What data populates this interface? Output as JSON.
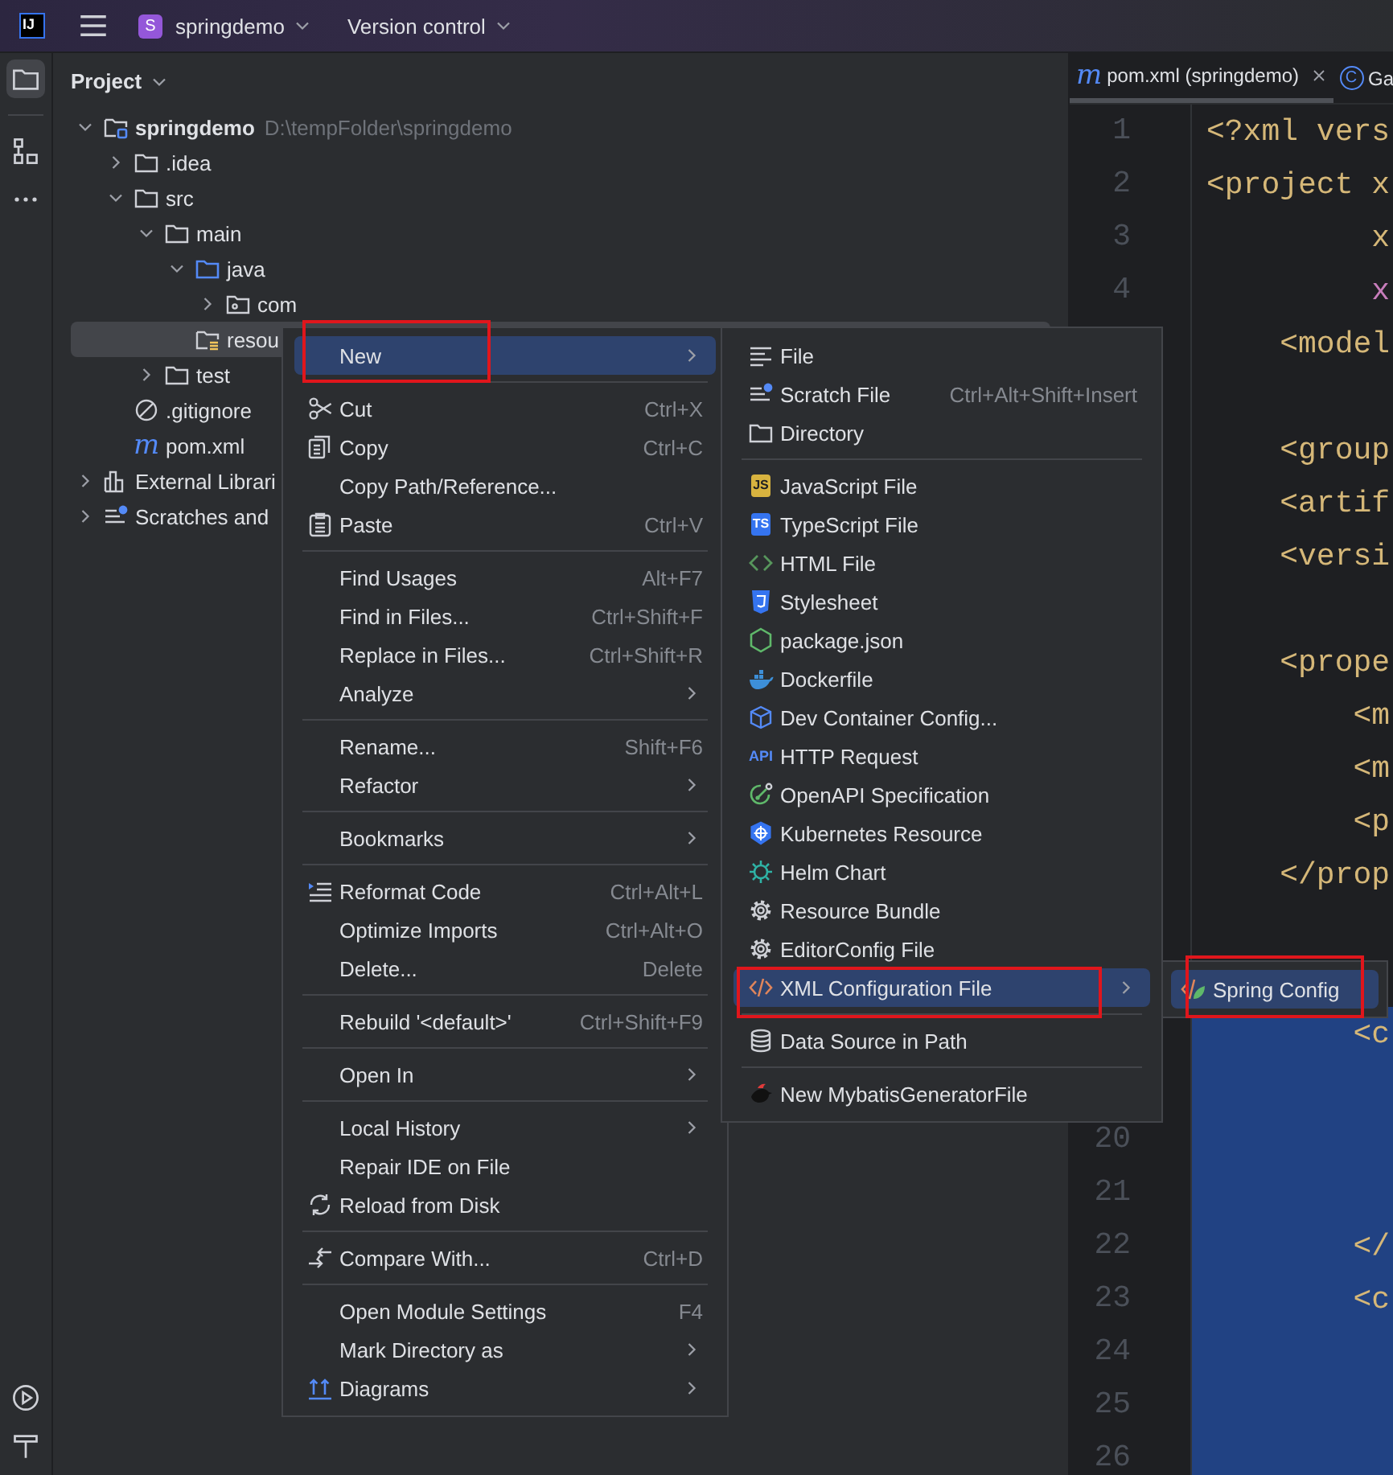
{
  "title_bar": {
    "logo": "IJ",
    "project_badge": "S",
    "project": "springdemo",
    "vcs": "Version control"
  },
  "tool_windows_top": [
    {
      "selected": true
    },
    {
      "selected": false
    },
    {
      "selected": false
    }
  ],
  "tool_windows_bottom": [
    {
      "selected": false
    },
    {
      "selected": false
    }
  ],
  "project_panel": {
    "title": "Project",
    "tree": [
      {
        "label": "springdemo",
        "path": "D:\\tempFolder\\springdemo",
        "kind": "module",
        "expanded": true,
        "selected": false,
        "children": [
          {
            "label": ".idea",
            "kind": "folder",
            "expanded": false,
            "selected": false
          },
          {
            "label": "src",
            "kind": "folder",
            "expanded": true,
            "selected": false,
            "children": [
              {
                "label": "main",
                "kind": "folder",
                "expanded": true,
                "selected": false,
                "children": [
                  {
                    "label": "java",
                    "kind": "source-folder",
                    "expanded": true,
                    "selected": false,
                    "children": [
                      {
                        "label": "com",
                        "kind": "package",
                        "expanded": false,
                        "selected": false
                      }
                    ]
                  },
                  {
                    "label": "resou",
                    "kind": "resources-folder",
                    "selected": true
                  }
                ]
              },
              {
                "label": "test",
                "kind": "folder",
                "expanded": false,
                "selected": false
              }
            ]
          },
          {
            "label": ".gitignore",
            "kind": "ignore-file",
            "selected": false
          },
          {
            "label": "pom.xml",
            "kind": "maven-file",
            "badge": "m",
            "selected": false
          }
        ]
      },
      {
        "label": "External Librari",
        "kind": "libraries",
        "expanded": false,
        "selected": false
      },
      {
        "label": "Scratches and",
        "kind": "scratches",
        "expanded": false,
        "selected": false
      }
    ]
  },
  "editor": {
    "tabs": [
      {
        "label": "pom.xml (springdemo)",
        "badge": "m",
        "kind": "maven",
        "selected": true,
        "closable": true
      },
      {
        "label": "Ga",
        "badge": "C",
        "kind": "class",
        "selected": false,
        "closable": false
      }
    ],
    "lines": [
      {
        "number": "1",
        "text": "<?xml vers",
        "kind": "tag",
        "selected": false
      },
      {
        "number": "2",
        "text": "<project x",
        "kind": "tag",
        "selected": false
      },
      {
        "number": "3",
        "text": "         x",
        "kind": "tag",
        "selected": false
      },
      {
        "number": "4",
        "text": "         x",
        "kind": "attribute",
        "selected": false
      },
      {
        "text": "    <model",
        "kind": "tag",
        "selected": false
      },
      {
        "selected": false
      },
      {
        "text": "    <group",
        "kind": "tag",
        "selected": false
      },
      {
        "text": "    <artif",
        "kind": "tag",
        "selected": false
      },
      {
        "text": "    <versi",
        "kind": "tag",
        "selected": false
      },
      {
        "selected": false
      },
      {
        "text": "    <prope",
        "kind": "tag",
        "selected": false
      },
      {
        "text": "        <m",
        "kind": "tag",
        "selected": false
      },
      {
        "text": "        <m",
        "kind": "tag",
        "selected": false
      },
      {
        "text": "        <p",
        "kind": "tag",
        "selected": false
      },
      {
        "text": "    </prop",
        "kind": "tag",
        "selected": false
      },
      {
        "selected": false
      },
      {
        "selected": false
      },
      {
        "text": "        <c",
        "kind": "tag",
        "selected": true
      },
      {
        "selected": true
      },
      {
        "number": "20",
        "selected": true
      },
      {
        "number": "21",
        "selected": true
      },
      {
        "number": "22",
        "text": "        </",
        "kind": "tag",
        "selected": true
      },
      {
        "number": "23",
        "text": "        <c",
        "kind": "tag",
        "selected": true
      },
      {
        "number": "24",
        "selected": true
      },
      {
        "number": "25",
        "selected": true
      },
      {
        "number": "26",
        "selected": true
      }
    ]
  },
  "menus": [
    {
      "groups": [
        [
          {
            "label": "New",
            "submenu": true,
            "selected": true,
            "marked": true
          }
        ],
        [
          {
            "label": "Cut",
            "shortcut": "Ctrl+X",
            "selected": false,
            "marked": false
          },
          {
            "label": "Copy",
            "shortcut": "Ctrl+C",
            "selected": false,
            "marked": false
          },
          {
            "label": "Copy Path/Reference...",
            "selected": false,
            "marked": false
          },
          {
            "label": "Paste",
            "shortcut": "Ctrl+V",
            "selected": false,
            "marked": false
          }
        ],
        [
          {
            "label": "Find Usages",
            "shortcut": "Alt+F7",
            "selected": false,
            "marked": false
          },
          {
            "label": "Find in Files...",
            "shortcut": "Ctrl+Shift+F",
            "selected": false,
            "marked": false
          },
          {
            "label": "Replace in Files...",
            "shortcut": "Ctrl+Shift+R",
            "selected": false,
            "marked": false
          },
          {
            "label": "Analyze",
            "submenu": true,
            "selected": false,
            "marked": false
          }
        ],
        [
          {
            "label": "Rename...",
            "shortcut": "Shift+F6",
            "selected": false,
            "marked": false
          },
          {
            "label": "Refactor",
            "submenu": true,
            "selected": false,
            "marked": false
          }
        ],
        [
          {
            "label": "Bookmarks",
            "submenu": true,
            "selected": false,
            "marked": false
          }
        ],
        [
          {
            "label": "Reformat Code",
            "shortcut": "Ctrl+Alt+L",
            "selected": false,
            "marked": false
          },
          {
            "label": "Optimize Imports",
            "shortcut": "Ctrl+Alt+O",
            "selected": false,
            "marked": false
          },
          {
            "label": "Delete...",
            "shortcut": "Delete",
            "selected": false,
            "marked": false
          }
        ],
        [
          {
            "label": "Rebuild '<default>'",
            "shortcut": "Ctrl+Shift+F9",
            "selected": false,
            "marked": false
          }
        ],
        [
          {
            "label": "Open In",
            "submenu": true,
            "selected": false,
            "marked": false
          }
        ],
        [
          {
            "label": "Local History",
            "submenu": true,
            "selected": false,
            "marked": false
          },
          {
            "label": "Repair IDE on File",
            "selected": false,
            "marked": false
          },
          {
            "label": "Reload from Disk",
            "selected": false,
            "marked": false
          }
        ],
        [
          {
            "label": "Compare With...",
            "shortcut": "Ctrl+D",
            "selected": false,
            "marked": false
          }
        ],
        [
          {
            "label": "Open Module Settings",
            "shortcut": "F4",
            "selected": false,
            "marked": false
          },
          {
            "label": "Mark Directory as",
            "submenu": true,
            "selected": false,
            "marked": false
          },
          {
            "label": "Diagrams",
            "submenu": true,
            "selected": false,
            "marked": false
          }
        ]
      ]
    },
    {
      "groups": [
        [
          {
            "label": "File",
            "selected": false,
            "marked": false
          },
          {
            "label": "Scratch File",
            "shortcut": "Ctrl+Alt+Shift+Insert",
            "selected": false,
            "marked": false
          },
          {
            "label": "Directory",
            "selected": false,
            "marked": false
          }
        ],
        [
          {
            "label": "JavaScript File",
            "badge": "JS",
            "selected": false,
            "marked": false
          },
          {
            "label": "TypeScript File",
            "badge": "TS",
            "selected": false,
            "marked": false
          },
          {
            "label": "HTML File",
            "selected": false,
            "marked": false
          },
          {
            "label": "Stylesheet",
            "selected": false,
            "marked": false
          },
          {
            "label": "package.json",
            "selected": false,
            "marked": false
          },
          {
            "label": "Dockerfile",
            "selected": false,
            "marked": false
          },
          {
            "label": "Dev Container Config...",
            "selected": false,
            "marked": false
          },
          {
            "label": "HTTP Request",
            "badge": "API",
            "selected": false,
            "marked": false
          },
          {
            "label": "OpenAPI Specification",
            "selected": false,
            "marked": false
          },
          {
            "label": "Kubernetes Resource",
            "selected": false,
            "marked": false
          },
          {
            "label": "Helm Chart",
            "selected": false,
            "marked": false
          },
          {
            "label": "Resource Bundle",
            "selected": false,
            "marked": false
          },
          {
            "label": "EditorConfig File",
            "selected": false,
            "marked": false
          },
          {
            "label": "XML Configuration File",
            "submenu": true,
            "selected": true,
            "marked": true
          }
        ],
        [
          {
            "label": "Data Source in Path",
            "selected": false,
            "marked": false
          }
        ],
        [
          {
            "label": "New MybatisGeneratorFile",
            "selected": false,
            "marked": false
          }
        ]
      ]
    },
    {
      "groups": [
        [
          {
            "label": "Spring Config",
            "selected": true,
            "marked": true
          }
        ]
      ]
    }
  ]
}
